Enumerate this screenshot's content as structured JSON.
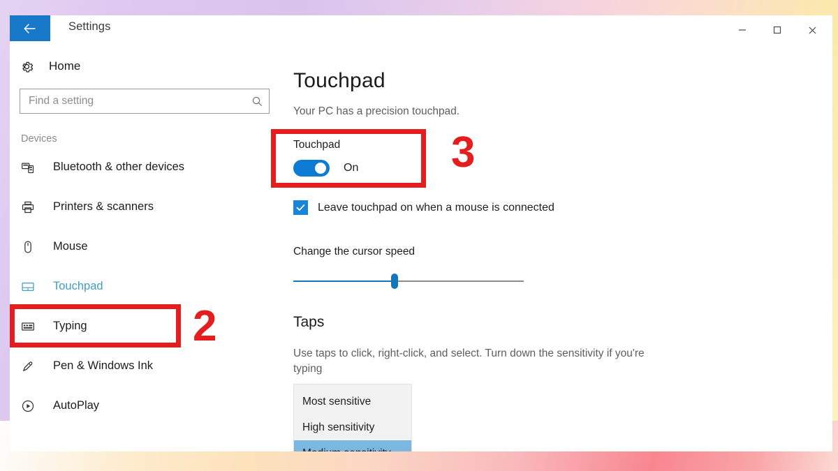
{
  "window": {
    "app_title": "Settings",
    "back_icon": "back-arrow-icon",
    "minimize_label": "–",
    "maximize_label": "□",
    "close_label": "✕"
  },
  "sidebar": {
    "home": {
      "label": "Home",
      "icon": "gear-icon"
    },
    "search": {
      "placeholder": "Find a setting",
      "value": "",
      "icon": "search-icon"
    },
    "group_label": "Devices",
    "items": [
      {
        "label": "Bluetooth & other devices",
        "icon": "bluetooth-devices-icon",
        "selected": false
      },
      {
        "label": "Printers & scanners",
        "icon": "printer-icon",
        "selected": false
      },
      {
        "label": "Mouse",
        "icon": "mouse-icon",
        "selected": false
      },
      {
        "label": "Touchpad",
        "icon": "touchpad-icon",
        "selected": true
      },
      {
        "label": "Typing",
        "icon": "keyboard-icon",
        "selected": false
      },
      {
        "label": "Pen & Windows Ink",
        "icon": "pen-icon",
        "selected": false
      },
      {
        "label": "AutoPlay",
        "icon": "autoplay-icon",
        "selected": false
      }
    ]
  },
  "main": {
    "title": "Touchpad",
    "subtitle": "Your PC has a precision touchpad.",
    "toggle": {
      "label": "Touchpad",
      "state_text": "On",
      "on": true
    },
    "checkbox": {
      "label": "Leave touchpad on when a mouse is connected",
      "checked": true
    },
    "cursor_speed": {
      "label": "Change the cursor speed",
      "percent": 44
    },
    "taps": {
      "title": "Taps",
      "description": "Use taps to click, right-click, and select. Turn down the sensitivity if you're typing"
    },
    "sensitivity_dropdown": {
      "options": [
        {
          "label": "Most sensitive",
          "selected": false
        },
        {
          "label": "High sensitivity",
          "selected": false
        },
        {
          "label": "Medium sensitivity",
          "selected": true
        }
      ]
    }
  },
  "annotations": {
    "step_2": "2",
    "step_3": "3"
  },
  "colors": {
    "accent_blue": "#0d7bd4",
    "back_button_blue": "#1778c8",
    "selected_item_teal": "#3f9ec4",
    "annotation_red": "#e41e1e",
    "dropdown_highlight": "#7bb8e0"
  }
}
